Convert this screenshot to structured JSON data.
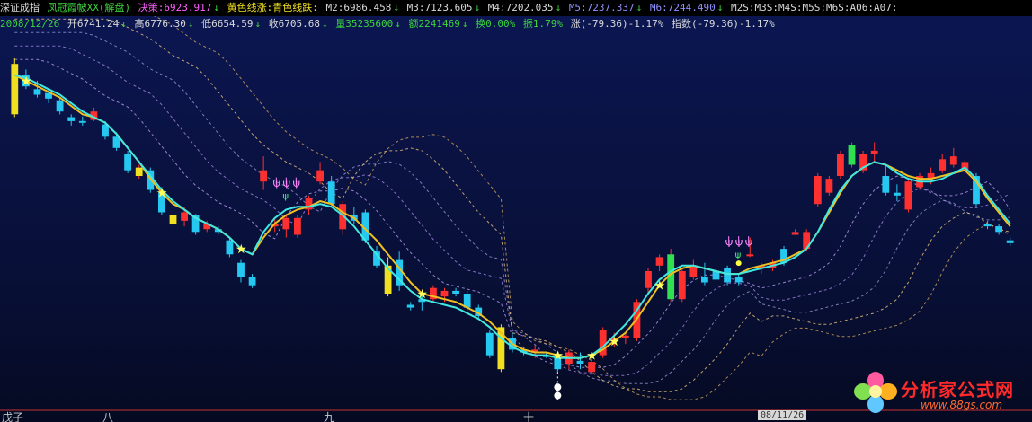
{
  "header": {
    "index_name": "深证成指",
    "indicator_name": "凤冠霞帔XX(解盘)",
    "decision_label": "决策:6923.917",
    "trend_note": "黄色线涨:青色线跌:",
    "ma_values": [
      "M2:6986.458",
      "M3:7123.605",
      "M4:7202.035",
      "M5:7237.337",
      "M6:7244.490"
    ],
    "extra_labels": "M2S:M3S:M4S:M5S:M6S:A06:A07:",
    "date": "2008/12/26",
    "open": "开6741.24",
    "high": "高6776.30",
    "low": "低6654.59",
    "close": "收6705.68",
    "volume": "量35235600",
    "amount": "额2241469",
    "turnover": "换0.00%",
    "amplitude": "振1.79%",
    "change": "涨(-79.36)-1.17%",
    "index_change": "指数(-79.36)-1.17%"
  },
  "arrows": {
    "down": "↓"
  },
  "colors": {
    "header_bg": "#000000",
    "chart_bg": "#0b1650",
    "bull": "#ff3030",
    "bear": "#25c8f0",
    "yellow_line": "#f0c020",
    "cyan_line": "#40e8e0",
    "white_dot": "#ffffff",
    "signal_pink": "#ff88ff",
    "label_green": "#3cd23c",
    "label_yellow": "#f0e020",
    "label_magenta": "#ff60ff",
    "label_purple": "#9090ff",
    "label_white": "#d8d8d8"
  },
  "x_axis_labels": [
    "戊子",
    "八",
    "九",
    "十"
  ],
  "last_date_label": "08/11/26",
  "watermark": {
    "text": "分析家公式网",
    "url": "www.88gs.com"
  },
  "chart_data": {
    "type": "candlestick",
    "title": "深证成指",
    "ylim": [
      6200,
      12900
    ],
    "candles": [
      {
        "o": 12400,
        "h": 12500,
        "l": 11450,
        "c": 11500,
        "color": "yellow"
      },
      {
        "o": 12200,
        "h": 12300,
        "l": 11950,
        "c": 12000
      },
      {
        "o": 11950,
        "h": 12100,
        "l": 11800,
        "c": 11850
      },
      {
        "o": 11880,
        "h": 11950,
        "l": 11700,
        "c": 11780
      },
      {
        "o": 11750,
        "h": 11800,
        "l": 11500,
        "c": 11550
      },
      {
        "o": 11450,
        "h": 11500,
        "l": 11300,
        "c": 11380
      },
      {
        "o": 11380,
        "h": 11460,
        "l": 11300,
        "c": 11350
      },
      {
        "o": 11400,
        "h": 11620,
        "l": 11380,
        "c": 11550
      },
      {
        "o": 11320,
        "h": 11380,
        "l": 11050,
        "c": 11100
      },
      {
        "o": 11100,
        "h": 11180,
        "l": 10850,
        "c": 10900
      },
      {
        "o": 10800,
        "h": 10850,
        "l": 10450,
        "c": 10500
      },
      {
        "o": 10400,
        "h": 10600,
        "l": 10350,
        "c": 10550,
        "color": "yellow"
      },
      {
        "o": 10500,
        "h": 10550,
        "l": 10100,
        "c": 10150
      },
      {
        "o": 10100,
        "h": 10200,
        "l": 9700,
        "c": 9750
      },
      {
        "o": 9550,
        "h": 9750,
        "l": 9450,
        "c": 9700,
        "color": "yellow"
      },
      {
        "o": 9600,
        "h": 9850,
        "l": 9500,
        "c": 9750
      },
      {
        "o": 9700,
        "h": 9720,
        "l": 9350,
        "c": 9400
      },
      {
        "o": 9450,
        "h": 9600,
        "l": 9400,
        "c": 9550
      },
      {
        "o": 9450,
        "h": 9500,
        "l": 9350,
        "c": 9400
      },
      {
        "o": 9250,
        "h": 9300,
        "l": 8950,
        "c": 9000
      },
      {
        "o": 8850,
        "h": 8900,
        "l": 8500,
        "c": 8600
      },
      {
        "o": 8600,
        "h": 8650,
        "l": 8400,
        "c": 8450
      },
      {
        "o": 10300,
        "h": 10750,
        "l": 10150,
        "c": 10500
      },
      {
        "o": 9500,
        "h": 9650,
        "l": 9400,
        "c": 9550
      },
      {
        "o": 9450,
        "h": 9700,
        "l": 9300,
        "c": 9650
      },
      {
        "o": 9350,
        "h": 9700,
        "l": 9300,
        "c": 9650
      },
      {
        "o": 9800,
        "h": 10050,
        "l": 9700,
        "c": 10000
      },
      {
        "o": 10300,
        "h": 10650,
        "l": 10250,
        "c": 10500
      },
      {
        "o": 10300,
        "h": 10400,
        "l": 9850,
        "c": 9900
      },
      {
        "o": 9450,
        "h": 9950,
        "l": 9350,
        "c": 9900
      },
      {
        "o": 9700,
        "h": 9850,
        "l": 9550,
        "c": 9600
      },
      {
        "o": 9750,
        "h": 9800,
        "l": 9200,
        "c": 9250
      },
      {
        "o": 9050,
        "h": 9150,
        "l": 8750,
        "c": 8800
      },
      {
        "o": 8800,
        "h": 8950,
        "l": 8250,
        "c": 8300,
        "color": "yellow"
      },
      {
        "o": 8900,
        "h": 9050,
        "l": 8350,
        "c": 8450
      },
      {
        "o": 8100,
        "h": 8150,
        "l": 8000,
        "c": 8050
      },
      {
        "o": 8200,
        "h": 8250,
        "l": 8000,
        "c": 8150
      },
      {
        "o": 8200,
        "h": 8450,
        "l": 8150,
        "c": 8400
      },
      {
        "o": 8250,
        "h": 8400,
        "l": 8150,
        "c": 8350
      },
      {
        "o": 8350,
        "h": 8400,
        "l": 8250,
        "c": 8300
      },
      {
        "o": 8300,
        "h": 8350,
        "l": 8000,
        "c": 8050
      },
      {
        "o": 8050,
        "h": 8100,
        "l": 7850,
        "c": 7900
      },
      {
        "o": 7600,
        "h": 7650,
        "l": 7150,
        "c": 7200
      },
      {
        "o": 7700,
        "h": 7750,
        "l": 6900,
        "c": 6950,
        "color": "yellow"
      },
      {
        "o": 7500,
        "h": 7600,
        "l": 7250,
        "c": 7300
      },
      {
        "o": 7300,
        "h": 7350,
        "l": 7200,
        "c": 7250
      },
      {
        "o": 7250,
        "h": 7380,
        "l": 7150,
        "c": 7300
      },
      {
        "o": 7200,
        "h": 7250,
        "l": 7150,
        "c": 7180
      },
      {
        "o": 7150,
        "h": 7200,
        "l": 6900,
        "c": 6950
      },
      {
        "o": 7050,
        "h": 7300,
        "l": 6950,
        "c": 7250
      },
      {
        "o": 7100,
        "h": 7250,
        "l": 6950,
        "c": 7050
      },
      {
        "o": 6900,
        "h": 7150,
        "l": 6850,
        "c": 7080
      },
      {
        "o": 7200,
        "h": 7700,
        "l": 7150,
        "c": 7650
      },
      {
        "o": 7450,
        "h": 7600,
        "l": 7350,
        "c": 7500
      },
      {
        "o": 7500,
        "h": 7600,
        "l": 7400,
        "c": 7550
      },
      {
        "o": 7500,
        "h": 8200,
        "l": 7450,
        "c": 8150
      },
      {
        "o": 8400,
        "h": 8750,
        "l": 8300,
        "c": 8700
      },
      {
        "o": 8800,
        "h": 9000,
        "l": 8700,
        "c": 8950
      },
      {
        "o": 8200,
        "h": 9100,
        "l": 8150,
        "c": 9000,
        "color": "green"
      },
      {
        "o": 8200,
        "h": 8750,
        "l": 8150,
        "c": 8700
      },
      {
        "o": 8600,
        "h": 8900,
        "l": 8550,
        "c": 8800
      },
      {
        "o": 8600,
        "h": 8850,
        "l": 8450,
        "c": 8500
      },
      {
        "o": 8700,
        "h": 8750,
        "l": 8500,
        "c": 8550
      },
      {
        "o": 8750,
        "h": 8800,
        "l": 8450,
        "c": 8500
      },
      {
        "o": 8600,
        "h": 8650,
        "l": 8450,
        "c": 8500
      },
      {
        "o": 9000,
        "h": 9300,
        "l": 8950,
        "c": 9000
      },
      {
        "o": 8750,
        "h": 8850,
        "l": 8650,
        "c": 8800
      },
      {
        "o": 8750,
        "h": 8900,
        "l": 8700,
        "c": 8850
      },
      {
        "o": 9100,
        "h": 9150,
        "l": 8800,
        "c": 8850
      },
      {
        "o": 9350,
        "h": 9450,
        "l": 9350,
        "c": 9400
      },
      {
        "o": 9100,
        "h": 9450,
        "l": 9050,
        "c": 9400
      },
      {
        "o": 9900,
        "h": 10450,
        "l": 9850,
        "c": 10400
      },
      {
        "o": 10100,
        "h": 10400,
        "l": 10050,
        "c": 10350
      },
      {
        "o": 10400,
        "h": 10850,
        "l": 10350,
        "c": 10800
      },
      {
        "o": 10600,
        "h": 11000,
        "l": 10550,
        "c": 10950,
        "color": "green"
      },
      {
        "o": 10500,
        "h": 10850,
        "l": 10450,
        "c": 10800
      },
      {
        "o": 10800,
        "h": 11000,
        "l": 10650,
        "c": 10850
      },
      {
        "o": 10400,
        "h": 10600,
        "l": 10050,
        "c": 10100
      },
      {
        "o": 10100,
        "h": 10250,
        "l": 9950,
        "c": 10050
      },
      {
        "o": 9800,
        "h": 10350,
        "l": 9750,
        "c": 10300
      },
      {
        "o": 10200,
        "h": 10450,
        "l": 10150,
        "c": 10400
      },
      {
        "o": 10350,
        "h": 10550,
        "l": 10250,
        "c": 10450
      },
      {
        "o": 10500,
        "h": 10800,
        "l": 10450,
        "c": 10700
      },
      {
        "o": 10600,
        "h": 10900,
        "l": 10550,
        "c": 10750
      },
      {
        "o": 10500,
        "h": 10700,
        "l": 10450,
        "c": 10650
      },
      {
        "o": 10400,
        "h": 10450,
        "l": 9850,
        "c": 9900
      },
      {
        "o": 9550,
        "h": 9600,
        "l": 9450,
        "c": 9500
      },
      {
        "o": 9500,
        "h": 9550,
        "l": 9350,
        "c": 9400
      },
      {
        "o": 9250,
        "h": 9300,
        "l": 9150,
        "c": 9200
      }
    ],
    "star_indices": [
      1,
      13,
      20,
      36,
      48,
      51,
      53,
      57
    ],
    "signal_indices": [
      24,
      64
    ],
    "yellow_line": [
      12200,
      12100,
      12000,
      11900,
      11800,
      11650,
      11500,
      11450,
      11350,
      11150,
      10900,
      10650,
      10350,
      10100,
      9900,
      9800,
      9650,
      9550,
      9450,
      9300,
      9100,
      9000,
      9300,
      9550,
      9700,
      9800,
      9850,
      9950,
      9900,
      9750,
      9650,
      9450,
      9250,
      9000,
      8750,
      8500,
      8300,
      8250,
      8200,
      8150,
      8050,
      7950,
      7800,
      7600,
      7400,
      7300,
      7250,
      7250,
      7200,
      7150,
      7150,
      7200,
      7300,
      7450,
      7600,
      7850,
      8150,
      8450,
      8650,
      8750,
      8800,
      8750,
      8700,
      8650,
      8650,
      8750,
      8800,
      8850,
      8900,
      9000,
      9100,
      9400,
      9750,
      10100,
      10400,
      10550,
      10650,
      10600,
      10500,
      10400,
      10350,
      10350,
      10400,
      10450,
      10500,
      10300,
      10000,
      9750,
      9500
    ],
    "cyan_line": [
      12200,
      12150,
      12050,
      11950,
      11850,
      11700,
      11550,
      11450,
      11350,
      11150,
      10900,
      10650,
      10400,
      10150,
      9950,
      9800,
      9650,
      9550,
      9450,
      9300,
      9100,
      9000,
      9400,
      9650,
      9800,
      9850,
      9850,
      9900,
      9850,
      9700,
      9500,
      9250,
      9000,
      8750,
      8550,
      8350,
      8200,
      8150,
      8100,
      8050,
      7950,
      7850,
      7700,
      7500,
      7350,
      7250,
      7200,
      7200,
      7150,
      7150,
      7150,
      7200,
      7350,
      7550,
      7750,
      8000,
      8300,
      8550,
      8700,
      8800,
      8800,
      8750,
      8700,
      8650,
      8650,
      8700,
      8750,
      8800,
      8850,
      8950,
      9100,
      9400,
      9800,
      10150,
      10400,
      10550,
      10650,
      10600,
      10450,
      10350,
      10300,
      10300,
      10350,
      10450,
      10550,
      10350,
      10050,
      9800,
      9550
    ],
    "band_offsets": [
      280,
      520,
      760,
      1000,
      1240
    ],
    "band_lag": [
      2,
      4,
      6,
      8,
      10
    ],
    "white_dot_values": [
      6630,
      6480
    ],
    "dotted_marker_index": 48
  }
}
